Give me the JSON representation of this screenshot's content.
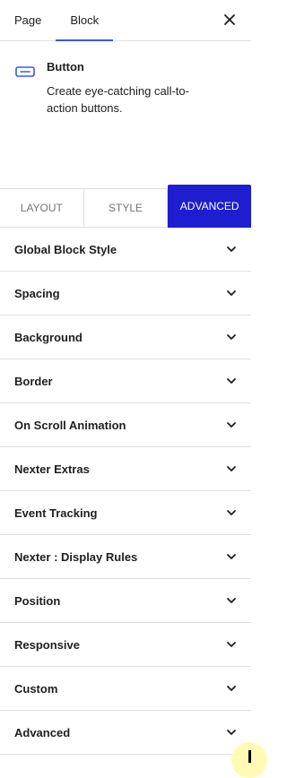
{
  "top_tabs": [
    {
      "label": "Page",
      "active": false
    },
    {
      "label": "Block",
      "active": true
    }
  ],
  "close_icon": "close-icon",
  "block": {
    "icon": "button-icon",
    "title": "Button",
    "description": "Create eye-catching call-to-action buttons."
  },
  "settings_tabs": [
    {
      "label": "LAYOUT",
      "active": false
    },
    {
      "label": "STYLE",
      "active": false
    },
    {
      "label": "ADVANCED",
      "active": true
    }
  ],
  "panels": [
    {
      "title": "Global Block Style"
    },
    {
      "title": "Spacing"
    },
    {
      "title": "Background"
    },
    {
      "title": "Border"
    },
    {
      "title": "On Scroll Animation"
    },
    {
      "title": "Nexter Extras"
    },
    {
      "title": "Event Tracking"
    },
    {
      "title": "Nexter : Display Rules"
    },
    {
      "title": "Position"
    },
    {
      "title": "Responsive"
    },
    {
      "title": "Custom"
    },
    {
      "title": "Advanced"
    }
  ],
  "colors": {
    "accent": "#1e1ed0",
    "tab_underline": "#3858e9",
    "icon": "#3858e9"
  }
}
